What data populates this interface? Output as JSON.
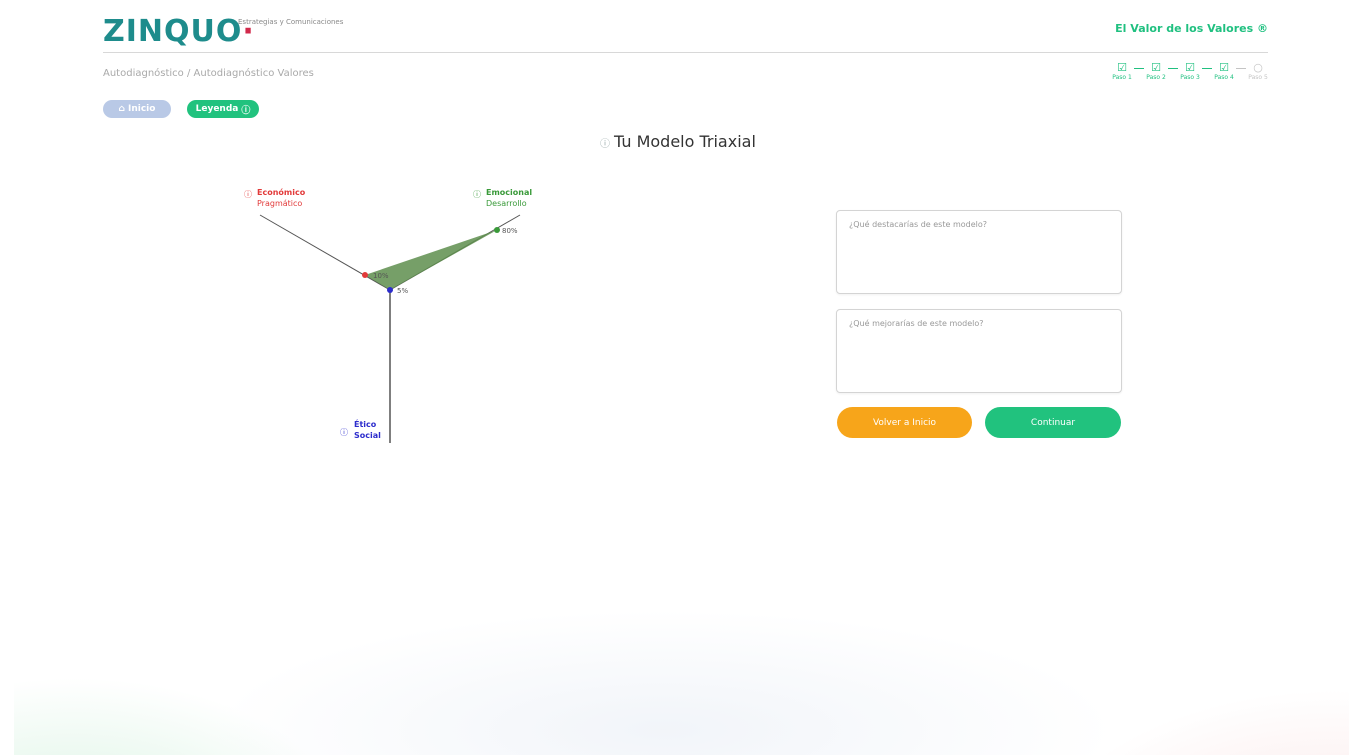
{
  "header": {
    "logo": "ZINQUO",
    "logo_accent": "·",
    "tagline": "Estrategias y Comunicaciones",
    "link": "El Valor de los Valores ®"
  },
  "breadcrumb": "Autodiagnóstico / Autodiagnóstico Valores",
  "steps": [
    {
      "label": "Paso 1",
      "state": "done"
    },
    {
      "label": "Paso 2",
      "state": "done"
    },
    {
      "label": "Paso 3",
      "state": "done"
    },
    {
      "label": "Paso 4",
      "state": "done"
    },
    {
      "label": "Paso 5",
      "state": "pending"
    }
  ],
  "buttons": {
    "inicio": "Inicio",
    "leyenda": "Leyenda",
    "secondary": "Volver a Inicio",
    "primary": "Continuar"
  },
  "title": "Tu Modelo Triaxial",
  "triaxial": {
    "axes": [
      {
        "label_line1": "Económico",
        "label_line2": "Pragmático",
        "color": "#e23a3a",
        "value_label": "10%"
      },
      {
        "label_line1": "Emocional",
        "label_line2": "Desarrollo",
        "color": "#3a9a3a",
        "value_label": "80%"
      },
      {
        "label_line1": "Ético",
        "label_line2": "Social",
        "color": "#2c2ccc",
        "value_label": "5%"
      }
    ],
    "fill_color": "#5e8e4e"
  },
  "inputs": {
    "q1_placeholder": "¿Qué destacarías de este modelo?",
    "q2_placeholder": "¿Qué mejorarías de este modelo?"
  },
  "colors": {
    "brand_teal": "#1e8c8c",
    "brand_red": "#d1294b",
    "accent_green": "#21c27e",
    "accent_orange": "#f7a51a"
  }
}
